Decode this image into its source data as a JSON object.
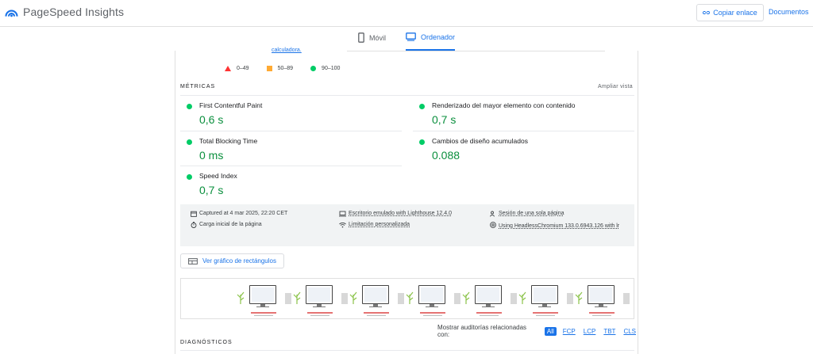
{
  "header": {
    "app_title": "PageSpeed Insights",
    "copy_link_label": "Copiar enlace",
    "docs_label": "Documentos"
  },
  "tabs": {
    "mobile": "Móvil",
    "desktop": "Ordenador",
    "active": "desktop"
  },
  "calc_link": "calculadora.",
  "legend": {
    "bad": "0–49",
    "average": "50–89",
    "good": "90–100",
    "colors": {
      "bad": "#ff3333",
      "average": "#ffaa33",
      "good": "#00cc66"
    }
  },
  "metrics": {
    "section_title": "MÉTRICAS",
    "expand_label": "Ampliar vista",
    "items": [
      {
        "label": "First Contentful Paint",
        "value": "0,6 s",
        "status": "good"
      },
      {
        "label": "Renderizado del mayor elemento con contenido",
        "value": "0,7 s",
        "status": "good"
      },
      {
        "label": "Total Blocking Time",
        "value": "0 ms",
        "status": "good"
      },
      {
        "label": "Cambios de diseño acumulados",
        "value": "0.088",
        "status": "good"
      },
      {
        "label": "Speed Index",
        "value": "0,7 s",
        "status": "good"
      }
    ]
  },
  "run_info": {
    "captured": "Captured at 4 mar 2025, 22:20 CET",
    "initial_load": "Carga inicial de la página",
    "emulated": "Escritorio emulado with Lighthouse 12.4.0",
    "throttling": "Limitación personalizada",
    "session": "Sesión de una sola página",
    "browser": "Using HeadlessChromium 133.0.6943.126 with lr"
  },
  "treemap_label": "Ver gráfico de rectángulos",
  "filmstrip": {
    "frames": 7
  },
  "audit_filter": {
    "label": "Mostrar auditorías relacionadas con:",
    "options": [
      "All",
      "FCP",
      "LCP",
      "TBT",
      "CLS"
    ],
    "active": "All"
  },
  "diagnostics_title": "DIAGNÓSTICOS"
}
